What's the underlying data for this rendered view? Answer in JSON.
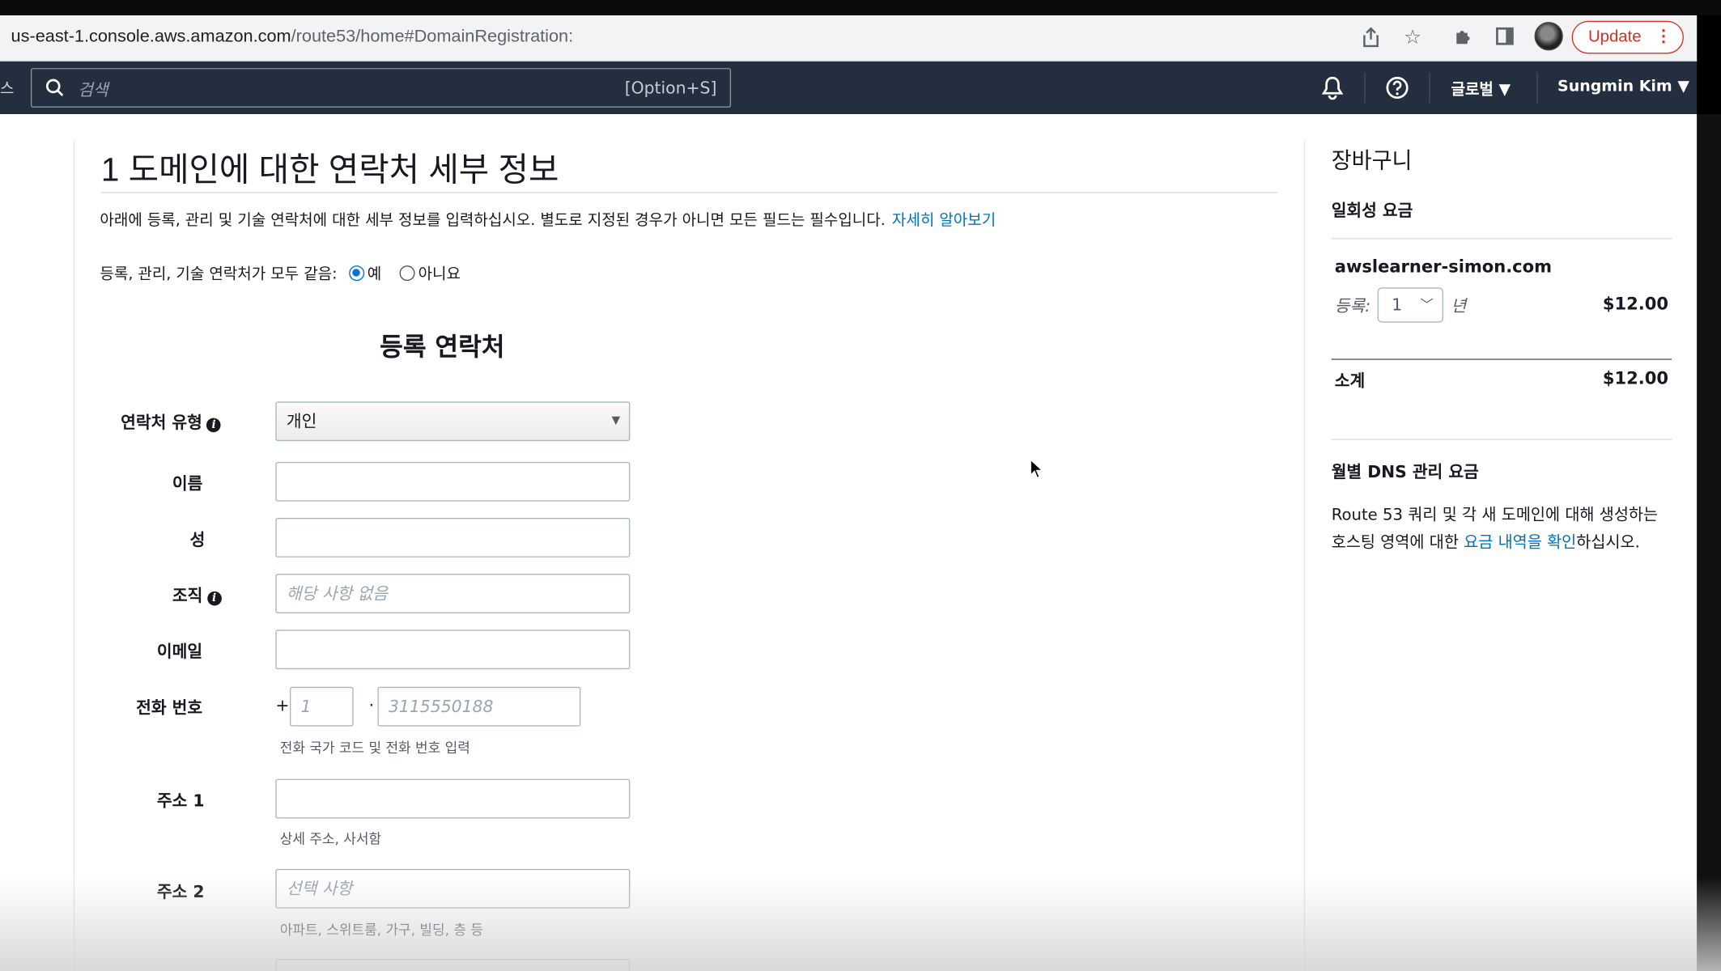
{
  "browser": {
    "url_host": "us-east-1.console.aws.amazon.com",
    "url_path": "/route53/home#DomainRegistration:",
    "update_label": "Update"
  },
  "aws_nav": {
    "left_edge_text": "스",
    "search_placeholder": "검색",
    "search_shortcut": "[Option+S]",
    "region": "글로벌",
    "user": "Sungmin Kim"
  },
  "form": {
    "title": "1 도메인에 대한 연락처 세부 정보",
    "description": "아래에 등록, 관리 및 기술 연락처에 대한 세부 정보를 입력하십시오. 별도로 지정된 경우가 아니면 모든 필드는 필수입니다.",
    "learn_more": "자세히 알아보기",
    "same_contacts_label": "등록, 관리, 기술 연락처가 모두 같음:",
    "yes": "예",
    "no": "아니요",
    "section_title": "등록 연락처",
    "contact_type_label": "연락처 유형",
    "contact_type_value": "개인",
    "first_name_label": "이름",
    "last_name_label": "성",
    "organization_label": "조직",
    "organization_placeholder": "해당 사항 없음",
    "email_label": "이메일",
    "phone_label": "전화 번호",
    "phone_plus": "+",
    "phone_code_placeholder": "1",
    "phone_sep": "·",
    "phone_number_placeholder": "3115550188",
    "phone_hint": "전화 국가 코드 및 전화 번호 입력",
    "address1_label": "주소 1",
    "address1_hint": "상세 주소, 사서함",
    "address2_label": "주소 2",
    "address2_placeholder": "선택 사항",
    "address2_hint": "아파트, 스위트룸, 가구, 빌딩, 층 등"
  },
  "cart": {
    "title": "장바구니",
    "one_time_heading": "일회성 요금",
    "domain": "awslearner-simon.com",
    "registration_label": "등록:",
    "years_value": "1",
    "years_unit": "년",
    "price": "$12.00",
    "subtotal_label": "소계",
    "subtotal": "$12.00",
    "monthly_heading": "월별 DNS 관리 요금",
    "monthly_text_before": "Route 53 쿼리 및 각 새 도메인에 대해 생성하는 호스팅 영역에 대한 ",
    "monthly_link": "요금 내역을 확인",
    "monthly_text_after": "하십시오."
  }
}
